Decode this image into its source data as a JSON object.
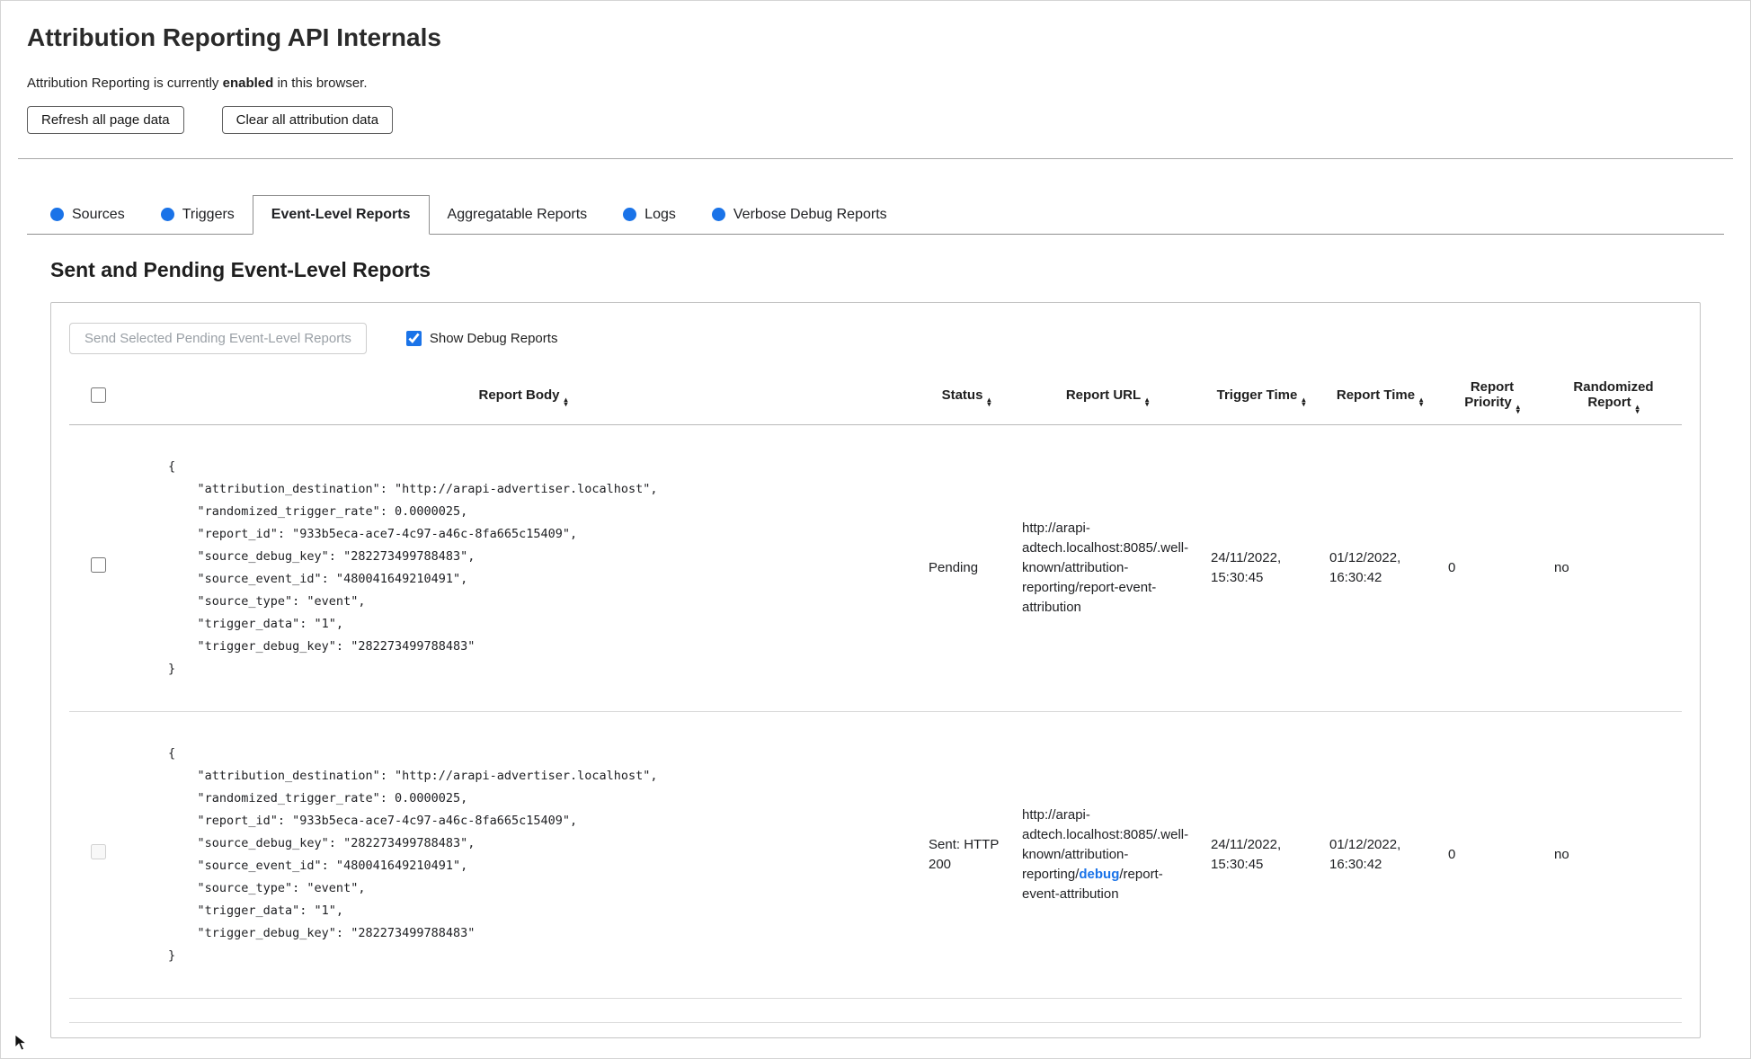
{
  "page": {
    "title": "Attribution Reporting API Internals",
    "status": {
      "prefix": "Attribution Reporting is currently ",
      "bold": "enabled",
      "suffix": " in this browser."
    },
    "buttons": {
      "refresh": "Refresh all page data",
      "clear": "Clear all attribution data"
    }
  },
  "tabs": [
    {
      "label": "Sources",
      "dot": true,
      "active": false
    },
    {
      "label": "Triggers",
      "dot": true,
      "active": false
    },
    {
      "label": "Event-Level Reports",
      "dot": false,
      "active": true
    },
    {
      "label": "Aggregatable Reports",
      "dot": false,
      "active": false
    },
    {
      "label": "Logs",
      "dot": true,
      "active": false
    },
    {
      "label": "Verbose Debug Reports",
      "dot": true,
      "active": false
    }
  ],
  "section": {
    "heading": "Sent and Pending Event-Level Reports",
    "send_button": "Send Selected Pending Event-Level Reports",
    "show_debug_label": "Show Debug Reports",
    "show_debug_checked": true
  },
  "icons": {
    "sort_up": "▴",
    "sort_down": "▾",
    "status_dot": "blue-circle-icon"
  },
  "colors": {
    "accent_blue": "#1a73e8"
  },
  "table": {
    "headers": [
      "Report Body",
      "Status",
      "Report URL",
      "Trigger Time",
      "Report Time",
      "Report Priority",
      "Randomized Report"
    ],
    "rows": [
      {
        "selectable": true,
        "checked": false,
        "report_body": "{\n    \"attribution_destination\": \"http://arapi-advertiser.localhost\",\n    \"randomized_trigger_rate\": 0.0000025,\n    \"report_id\": \"933b5eca-ace7-4c97-a46c-8fa665c15409\",\n    \"source_debug_key\": \"282273499788483\",\n    \"source_event_id\": \"480041649210491\",\n    \"source_type\": \"event\",\n    \"trigger_data\": \"1\",\n    \"trigger_debug_key\": \"282273499788483\"\n}",
        "status": "Pending",
        "report_url": [
          {
            "text": "http://arapi-adtech.localhost:8085/.well-known/attribution-reporting/report-event-attribution",
            "link": false
          }
        ],
        "trigger_time": "24/11/2022, 15:30:45",
        "report_time": "01/12/2022, 16:30:42",
        "report_priority": "0",
        "randomized_report": "no"
      },
      {
        "selectable": false,
        "checked": false,
        "report_body": "{\n    \"attribution_destination\": \"http://arapi-advertiser.localhost\",\n    \"randomized_trigger_rate\": 0.0000025,\n    \"report_id\": \"933b5eca-ace7-4c97-a46c-8fa665c15409\",\n    \"source_debug_key\": \"282273499788483\",\n    \"source_event_id\": \"480041649210491\",\n    \"source_type\": \"event\",\n    \"trigger_data\": \"1\",\n    \"trigger_debug_key\": \"282273499788483\"\n}",
        "status": "Sent: HTTP 200",
        "report_url": [
          {
            "text": "http://arapi-adtech.localhost:8085/.well-known/attribution-reporting/",
            "link": false
          },
          {
            "text": "debug",
            "link": true
          },
          {
            "text": "/report-event-attribution",
            "link": false
          }
        ],
        "trigger_time": "24/11/2022, 15:30:45",
        "report_time": "01/12/2022, 16:30:42",
        "report_priority": "0",
        "randomized_report": "no"
      }
    ]
  }
}
